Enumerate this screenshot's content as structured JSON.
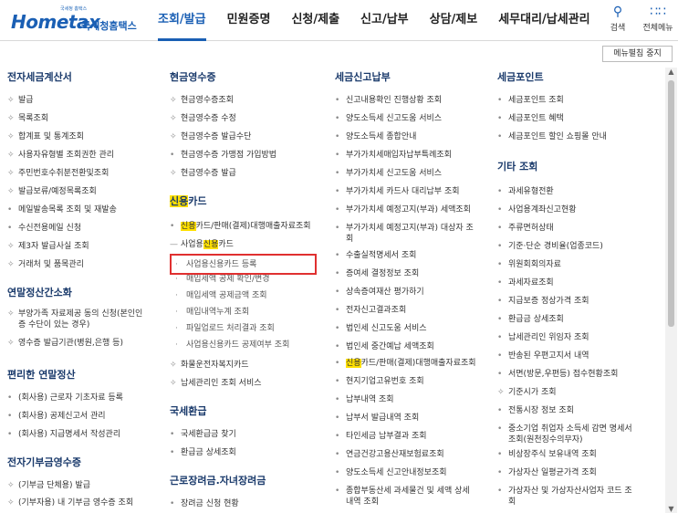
{
  "header": {
    "logo_small": "국세청 홈택스",
    "logo_word": "Hometax",
    "logo_ko": "국세청홈택스",
    "nav": [
      "조회/발급",
      "민원증명",
      "신청/제출",
      "신고/납부",
      "상담/제보",
      "세무대리/납세관리"
    ],
    "search_label": "검색",
    "allmenu_label": "전체메뉴"
  },
  "menu_stop_label": "메뉴펼침 중지",
  "col1": {
    "s1_title": "전자세금계산서",
    "s1_items": [
      "발급",
      "목록조회",
      "합계표 및 통계조회",
      "사용자유형별 조회권한 관리",
      "주민번호수취분전환및조회",
      "발급보류/예정목록조회",
      "메일발송목록 조회 및 재발송",
      "수신전용메일 신청",
      "제3자 발급사실 조회",
      "거래처 및 품목관리"
    ],
    "s2_title": "연말정산간소화",
    "s2_items": [
      "부양가족 자료제공 동의 신청(본인인",
      "증 수단이 있는 경우)",
      "영수증 발급기관(병원,은행 등)"
    ],
    "s3_title": "편리한 연말정산",
    "s3_items": [
      "(회사용) 근로자 기초자료 등록",
      "(회사용) 공제신고서 관리",
      "(회사용) 지급명세서 작성관리"
    ],
    "s4_title": "전자기부금영수증",
    "s4_items": [
      "(기부금 단체용) 발급",
      "(기부자용) 내 기부금 영수증 조회"
    ]
  },
  "col2": {
    "s1_title": "현금영수증",
    "s1_items": [
      "현금영수증조회",
      "현금영수증 수정",
      "현금영수증 발급수단",
      "현금영수증 가맹점 가입방법",
      "현금영수증 발급"
    ],
    "s2_title_hl": "신용",
    "s2_title_rest": "카드",
    "s2_item1_hl": "신용",
    "s2_item1_rest": "카드/판매(결제)대행매출자료조회",
    "s2_item2_pre": "사업용",
    "s2_item2_hl": "신용",
    "s2_item2_rest": "카드",
    "s2_subs": [
      "사업용신용카드 등록",
      "매입세액 공제 확인/변경",
      "매입세액 공제금액 조회",
      "매입내역누계 조회",
      "파일업로드 처리결과 조회",
      "사업용신용카드 공제여부 조회"
    ],
    "s2_more": [
      "화물운전자복지카드",
      "납세관리인 조회 서비스"
    ],
    "s3_title": "국세환급",
    "s3_items": [
      "국세환급금 찾기",
      "환급금 상세조회"
    ],
    "s4_title": "근로장려금.자녀장려금",
    "s4_items": [
      "장려금 신청 현황"
    ]
  },
  "col3": {
    "s1_title": "세금신고납부",
    "s1_items": [
      "신고내용확인 진행상황 조회",
      "양도소득세 신고도움 서비스",
      "양도소득세 종합안내",
      "부가가치세매입자납부특례조회",
      "부가가치세 신고도움 서비스",
      "부가가치세 카드사 대리납부 조회",
      "부가가치세 예정고지(부과) 세액조회",
      "부가가치세 예정고지(부과) 대상자 조",
      "회",
      "수출실적명세서 조회",
      "증여세 결정정보 조회",
      "상속증여재산 평가하기",
      "전자신고결과조회",
      "법인세 신고도움 서비스",
      "법인세 중간예납 세액조회"
    ],
    "hl_item_hl": "신용",
    "hl_item_rest": "카드/판매(결제)대행매출자료조회",
    "s1_more": [
      "현지기업고유번호 조회",
      "납부내역 조회",
      "납부서 발급내역 조회",
      "타인세금 납부결과 조회",
      "연금건강고용산재보험료조회",
      "양도소득세 신고안내정보조회",
      "종합부동산세 과세물건 및 세액 상세",
      "내역 조회"
    ]
  },
  "col4": {
    "s1_title": "세금포인트",
    "s1_items": [
      "세금포인트 조회",
      "세금포인트 혜택",
      "세금포인트 할인 쇼핑몰 안내"
    ],
    "s2_title": "기타 조회",
    "s2_items": [
      "과세유형전환",
      "사업용계좌신고현황",
      "주류면허상태",
      "기준·단순 경비율(업종코드)",
      "위원회회의자료",
      "과세자료조회",
      "지급보증 정상가격 조회",
      "환급금 상세조회",
      "납세관리인 위임자 조회",
      "반송된 우편고지서 내역",
      "서면(방문,우편등) 접수현황조회",
      "기준시가 조회",
      "전통시장 정보 조회",
      "중소기업 취업자 소득세 감면 명세서",
      "조회(원천징수의무자)",
      "비상장주식 보유내역 조회",
      "가상자산 일평균가격 조회",
      "가상자산 및 가상자산사업자 코드 조",
      "회"
    ]
  },
  "colors": {
    "accent": "#1a5fb4",
    "highlight": "#ffe000",
    "redbox": "#e03030"
  }
}
